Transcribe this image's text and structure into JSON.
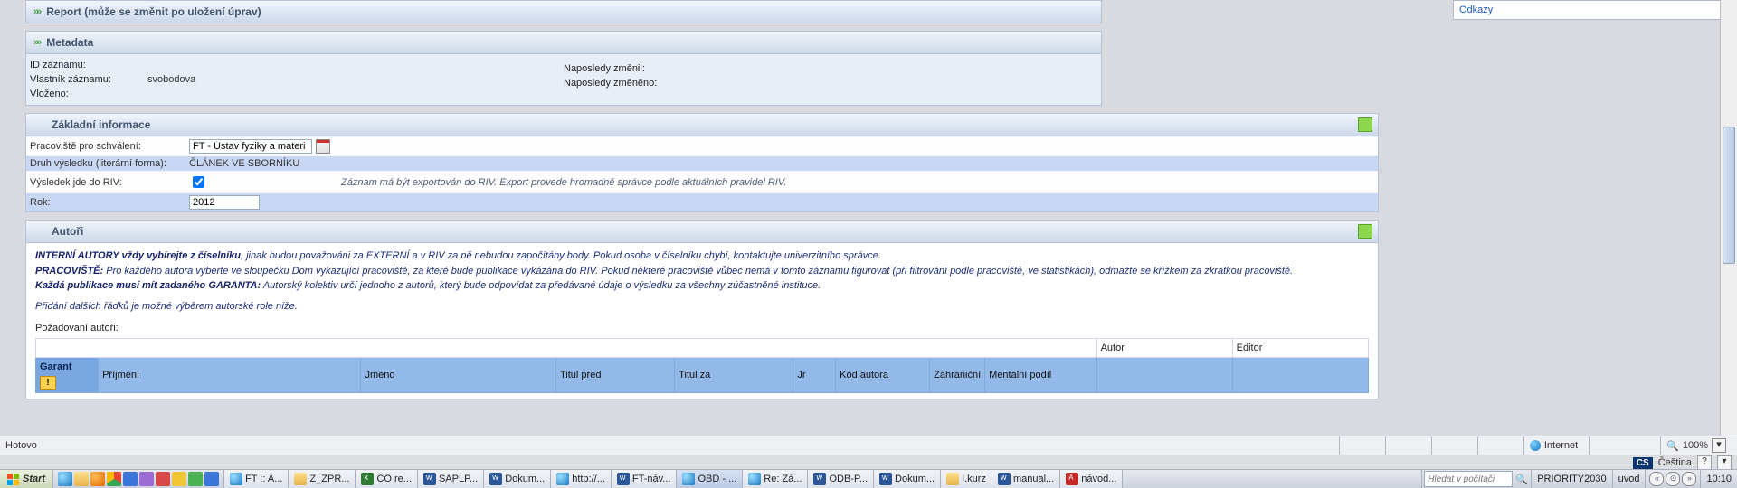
{
  "sections": {
    "report_title": "Report (může se změnit po uložení úprav)",
    "metadata_title": "Metadata",
    "basic_title": "Základní informace",
    "authors_title": "Autoři"
  },
  "side": {
    "odkazy": "Odkazy"
  },
  "metadata": {
    "id_label": "ID záznamu:",
    "owner_label": "Vlastník záznamu:",
    "owner_value": "svobodova",
    "inserted_label": "Vloženo:",
    "last_by_label": "Naposledy změnil:",
    "last_at_label": "Naposledy změněno:"
  },
  "basic": {
    "workplace_label": "Pracoviště pro schválení:",
    "workplace_value": "FT - Ústav fyziky a materi",
    "form_label": "Druh výsledku (literární forma):",
    "form_value": "ČLÁNEK VE SBORNÍKU",
    "riv_label": "Výsledek jde do RIV:",
    "riv_note": "Záznam má být exportován do RIV. Export provede hromadně správce podle aktuálních pravidel RIV.",
    "year_label": "Rok:",
    "year_value": "2012"
  },
  "authors_info": {
    "l1a": "INTERNÍ AUTORY vždy vybírejte z číselníku",
    "l1b": ", jinak budou považováni za EXTERNÍ a v RIV za ně nebudou započítány body. Pokud osoba v číselníku chybí, kontaktujte univerzitního správce.",
    "l2a": "PRACOVIŠTĚ:",
    "l2b": " Pro každého autora vyberte ve sloupečku Dom vykazující pracoviště, za které bude publikace vykázána do RIV. Pokud některé pracoviště vůbec nemá v tomto záznamu figurovat (při filtrování podle pracoviště, ve statistikách), odmažte se křížkem za zkratkou pracoviště.",
    "l3a": "Každá publikace musí mít zadaného GARANTA:",
    "l3b": " Autorský kolektiv určí jednoho z autorů, který bude odpovídat za předávané údaje o výsledku za všechny zúčastněné instituce.",
    "l4": "Přidání dalších řádků je možné výběrem autorské role níže.",
    "req": "Požadovaní autoři:",
    "sup_author": "Autor",
    "sup_editor": "Editor"
  },
  "cols": {
    "garant": "Garant",
    "prijmeni": "Příjmení",
    "jmeno": "Jméno",
    "titul_pred": "Titul před",
    "titul_za": "Titul za",
    "jr": "Jr",
    "kod": "Kód autora",
    "zahr": "Zahraniční",
    "mental": "Mentální podíl"
  },
  "status": {
    "ready": "Hotovo",
    "internet": "Internet",
    "zoom": "100%"
  },
  "lang": {
    "code": "CS",
    "name": "Čeština"
  },
  "taskbar": {
    "start": "Start",
    "tasks": [
      {
        "icon": "t-ie",
        "label": "FT :: A..."
      },
      {
        "icon": "t-fol",
        "label": "Z_ZPR..."
      },
      {
        "icon": "t-xls",
        "label": "CO re..."
      },
      {
        "icon": "t-word",
        "label": "SAPLP..."
      },
      {
        "icon": "t-word",
        "label": "Dokum..."
      },
      {
        "icon": "t-ie",
        "label": "http://..."
      },
      {
        "icon": "t-word",
        "label": "FT-náv..."
      },
      {
        "icon": "t-ie",
        "label": "OBD - ...",
        "active": true
      },
      {
        "icon": "t-ie",
        "label": "Re: Zá..."
      },
      {
        "icon": "t-word",
        "label": "ODB-P..."
      },
      {
        "icon": "t-word",
        "label": "Dokum..."
      },
      {
        "icon": "t-fol",
        "label": "I.kurz"
      },
      {
        "icon": "t-word",
        "label": "manual..."
      },
      {
        "icon": "t-pdf",
        "label": "návod..."
      }
    ],
    "search_placeholder": "Hledat v počítači",
    "tray_text1": "PRIORITY2030",
    "tray_text2": "uvod",
    "clock": "10:10"
  }
}
